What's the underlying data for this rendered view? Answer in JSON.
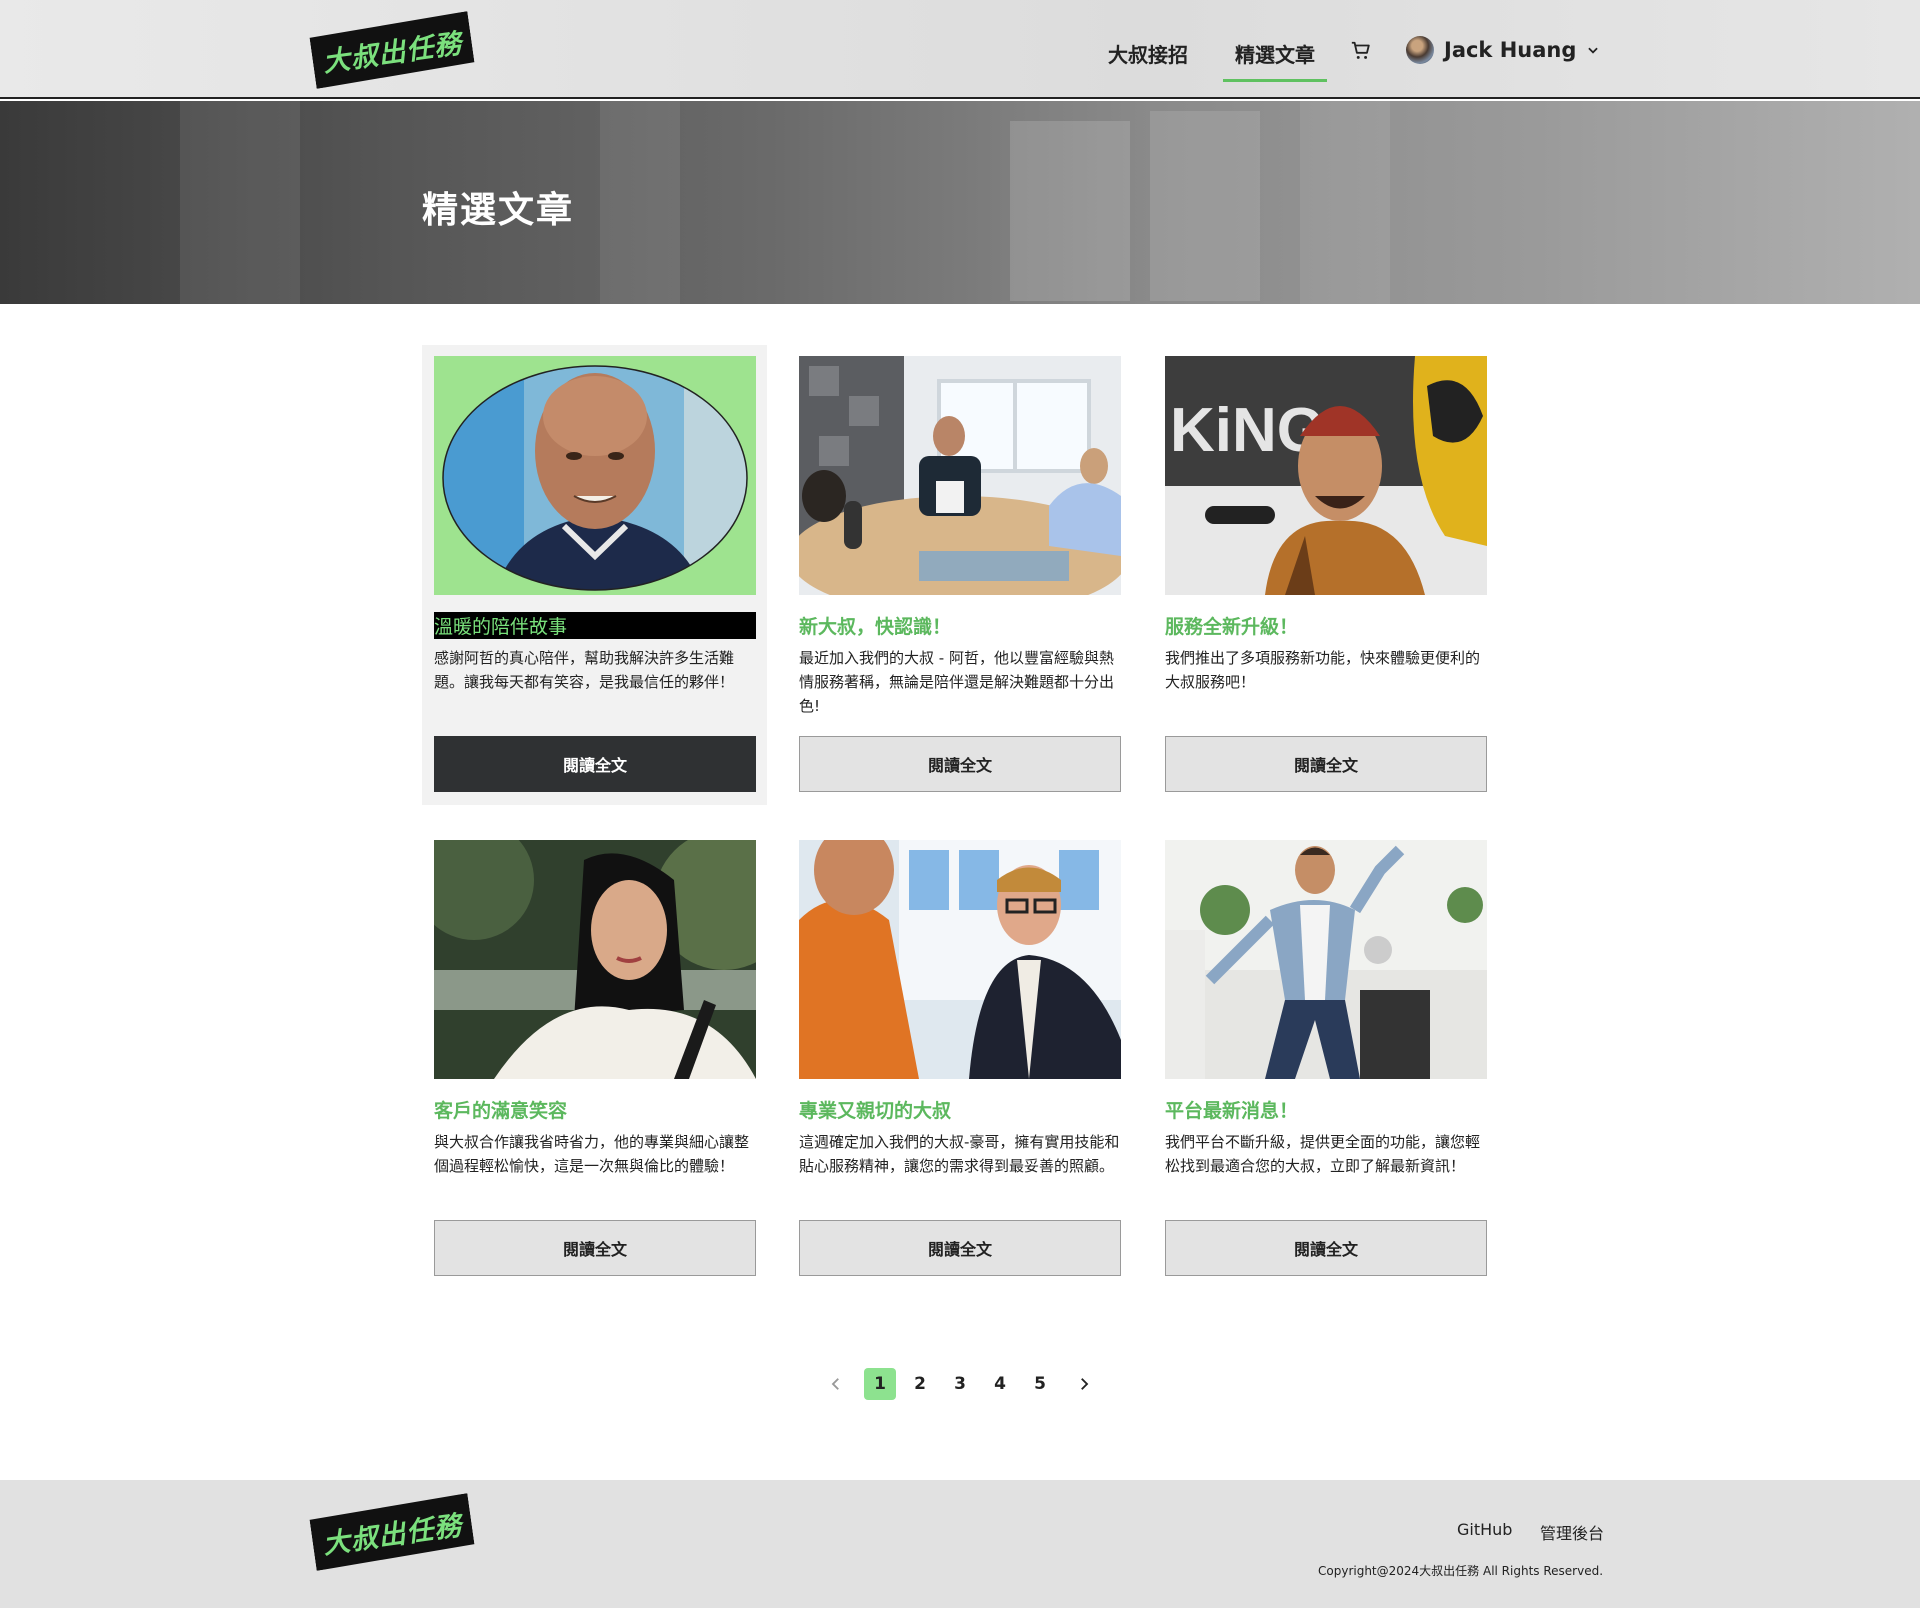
{
  "header": {
    "logo_text": "大叔出任務",
    "nav": [
      {
        "label": "大叔接招"
      },
      {
        "label": "精選文章"
      }
    ],
    "cart_icon": "cart-icon",
    "user_name": "Jack Huang",
    "chevron_icon": "chevron-down-icon"
  },
  "banner": {
    "title": "精選文章"
  },
  "cards": [
    {
      "title": "溫暖的陪伴故事",
      "text": "感謝阿哲的真心陪伴，幫助我解決許多生活難題。讓我每天都有笑容，是我最信任的夥伴！",
      "button": "閱讀全文"
    },
    {
      "title": "新大叔，快認識！",
      "text": "最近加入我們的大叔 - 阿哲，他以豐富經驗與熱情服務著稱，無論是陪伴還是解決難題都十分出色!",
      "button": "閱讀全文"
    },
    {
      "title": "服務全新升級！",
      "text": "我們推出了多項服務新功能，快來體驗更便利的大叔服務吧！",
      "button": "閱讀全文"
    },
    {
      "title": "客戶的滿意笑容",
      "text": "與大叔合作讓我省時省力，他的專業與細心讓整個過程輕松愉快，這是一次無與倫比的體驗！",
      "button": "閱讀全文"
    },
    {
      "title": "專業又親切的大叔",
      "text": "這週確定加入我們的大叔-豪哥，擁有實用技能和貼心服務精神，讓您的需求得到最妥善的照顧。",
      "button": "閱讀全文"
    },
    {
      "title": "平台最新消息！",
      "text": "我們平台不斷升級，提供更全面的功能，讓您輕松找到最適合您的大叔，立即了解最新資訊！",
      "button": "閱讀全文"
    }
  ],
  "pagination": {
    "pages": [
      "1",
      "2",
      "3",
      "4",
      "5"
    ],
    "current": "1",
    "prev_icon": "chevron-left-icon",
    "next_icon": "chevron-right-icon"
  },
  "footer": {
    "logo_text": "大叔出任務",
    "links": [
      {
        "label": "GitHub"
      },
      {
        "label": "管理後台"
      }
    ],
    "copyright": "Copyright@2024大叔出任務 All Rights Reserved."
  },
  "colors": {
    "accent_green": "#5cb85e",
    "highlight_green": "#8de28f",
    "dark_button": "#2f3133"
  }
}
